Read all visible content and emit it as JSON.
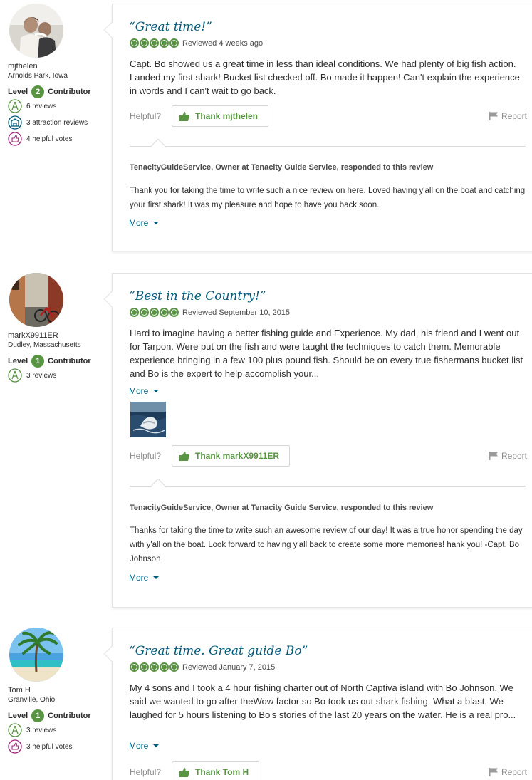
{
  "reviews": [
    {
      "member": {
        "username": "mjthelen",
        "location": "Arnolds Park, Iowa",
        "level_prefix": "Level",
        "level_number": "2",
        "level_suffix": "Contributor",
        "badges": [
          {
            "icon": "reviews-badge-icon",
            "text": "6 reviews"
          },
          {
            "icon": "attraction-reviews-icon",
            "text": "3 attraction reviews"
          },
          {
            "icon": "helpful-votes-icon",
            "text": "4 helpful votes"
          }
        ]
      },
      "title": "“Great time!”",
      "rating": 5,
      "date_text": "Reviewed 4 weeks ago",
      "body": "Capt. Bo showed us a great time in less than ideal conditions. We had plenty of big fish action. Landed my first shark! Bucket list checked off. Bo made it happen! Can't explain the experience in words and I can't wait to go back.",
      "helpful_label": "Helpful?",
      "thank_label": "Thank mjthelen",
      "report_label": "Report",
      "response": {
        "header": "TenacityGuideService, Owner at Tenacity Guide Service, responded to this review",
        "text": "Thank you for taking the time to write such a nice review on here. Loved having y'all on the boat and catching your first shark! It was my pleasure and hope to have you back soon.",
        "more_label": "More"
      }
    },
    {
      "member": {
        "username": "markX9911ER",
        "location": "Dudley, Massachusetts",
        "level_prefix": "Level",
        "level_number": "1",
        "level_suffix": "Contributor",
        "badges": [
          {
            "icon": "reviews-badge-icon",
            "text": "3 reviews"
          }
        ]
      },
      "title": "“Best in the Country!”",
      "rating": 5,
      "date_text": "Reviewed September 10, 2015",
      "body": "Hard to imagine having a better fishing guide and Experience. My dad, his friend and I went out for Tarpon. Were put on the fish and were taught the techniques to catch them. Memorable experience bringing in a few 100 plus pound fish. Should be on every true fishermans bucket list and Bo is the expert to help accomplish your...",
      "more_label": "More",
      "helpful_label": "Helpful?",
      "thank_label": "Thank markX9911ER",
      "report_label": "Report",
      "response": {
        "header": "TenacityGuideService, Owner at Tenacity Guide Service, responded to this review",
        "text": "Thanks for taking the time to write such an awesome review of our day! It was a true honor spending the day with y'all on the boat. Look forward to having y'all back to create some more memories! hank you! -Capt. Bo Johnson",
        "more_label": "More"
      }
    },
    {
      "member": {
        "username": "Tom H",
        "location": "Granville, Ohio",
        "level_prefix": "Level",
        "level_number": "1",
        "level_suffix": "Contributor",
        "badges": [
          {
            "icon": "reviews-badge-icon",
            "text": "3 reviews"
          },
          {
            "icon": "helpful-votes-icon",
            "text": "3 helpful votes"
          }
        ]
      },
      "title": "“Great time. Great guide Bo”",
      "rating": 5,
      "date_text": "Reviewed January 7, 2015",
      "body": "My 4 sons and I took a 4 hour fishing charter out of North Captiva island with Bo Johnson. We said we wanted to go after theWow factor so Bo took us out shark fishing. What a blast. We laughed for 5 hours listening to Bo's stories of the last 20 years on the water. He is a real pro...",
      "more_label": "More",
      "helpful_label": "Helpful?",
      "thank_label": "Thank Tom H",
      "report_label": "Report"
    }
  ],
  "colors": {
    "brand_green": "#589442",
    "link_blue": "#00587a"
  }
}
